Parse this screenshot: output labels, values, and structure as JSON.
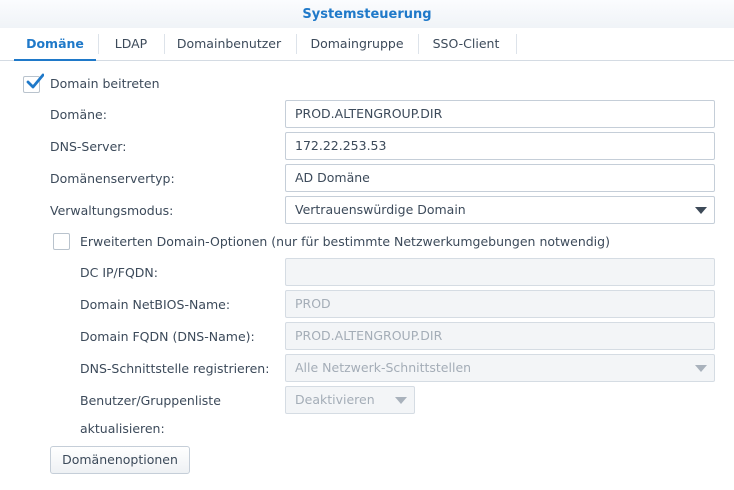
{
  "window": {
    "title": "Systemsteuerung"
  },
  "tabs": [
    {
      "label": "Domäne",
      "active": true
    },
    {
      "label": "LDAP"
    },
    {
      "label": "Domainbenutzer"
    },
    {
      "label": "Domaingruppe"
    },
    {
      "label": "SSO-Client"
    }
  ],
  "join_domain": {
    "label": "Domain beitreten",
    "checked": true
  },
  "form": {
    "domain": {
      "label": "Domäne:",
      "value": "PROD.ALTENGROUP.DIR"
    },
    "dns_server": {
      "label": "DNS-Server:",
      "value": "172.22.253.53"
    },
    "server_type": {
      "label": "Domänenservertyp:",
      "value": "AD Domäne"
    },
    "management_mode": {
      "label": "Verwaltungsmodus:",
      "value": "Vertrauenswürdige Domain"
    }
  },
  "advanced": {
    "label": "Erweiterten Domain-Optionen (nur für bestimmte Netzwerkumgebungen notwendig)",
    "checked": false,
    "dc_ip": {
      "label": "DC IP/FQDN:",
      "value": ""
    },
    "netbios": {
      "label": "Domain NetBIOS-Name:",
      "value": "PROD"
    },
    "fqdn": {
      "label": "Domain FQDN (DNS-Name):",
      "value": "PROD.ALTENGROUP.DIR"
    },
    "dns_interface": {
      "label": "DNS-Schnittstelle registrieren:",
      "value": "Alle Netzwerk-Schnittstellen"
    },
    "update_list": {
      "label_line1": "Benutzer/Gruppenliste",
      "label_line2": "aktualisieren:",
      "value": "Deaktivieren"
    }
  },
  "domain_options_button": {
    "label": "Domänenoptionen"
  },
  "icons": {
    "checkmark": "check-icon",
    "dropdown": "chevron-down-icon"
  },
  "colors": {
    "accent": "#1f79c9",
    "text": "#3c4a5a",
    "disabled_text": "#a4adb7"
  }
}
